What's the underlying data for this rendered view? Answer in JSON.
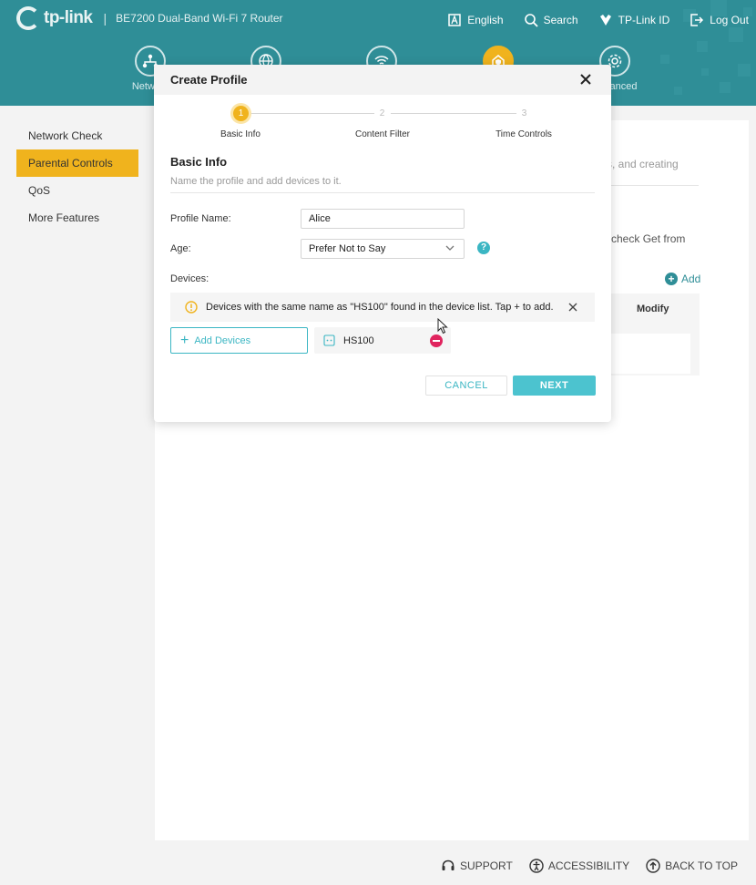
{
  "header": {
    "brand": "tp-link",
    "model": "BE7200 Dual-Band Wi-Fi 7 Router",
    "nav": [
      {
        "label": "English",
        "icon": "language-icon"
      },
      {
        "label": "Search",
        "icon": "search-icon"
      },
      {
        "label": "TP-Link ID",
        "icon": "tplink-id-icon"
      },
      {
        "label": "Log Out",
        "icon": "logout-icon"
      }
    ],
    "modules": [
      {
        "label": "Network",
        "icon": "network-icon"
      },
      {
        "label": "",
        "icon": "internet-icon"
      },
      {
        "label": "",
        "icon": "wireless-icon"
      },
      {
        "label": "",
        "icon": "security-icon",
        "active": true
      },
      {
        "label": "Advanced",
        "icon": "advanced-icon"
      }
    ],
    "accent": "#2f8e97",
    "active_color": "#f0b31d"
  },
  "sidebar": {
    "items": [
      {
        "label": "Network Check"
      },
      {
        "label": "Parental Controls",
        "active": true
      },
      {
        "label": "QoS"
      },
      {
        "label": "More Features"
      }
    ]
  },
  "background": {
    "text1": "mits, and creating",
    "text2": "o check Get from",
    "add_label": "Add",
    "modify_header": "Modify"
  },
  "modal": {
    "title": "Create Profile",
    "steps": [
      {
        "number": "1",
        "label": "Basic Info",
        "active": true
      },
      {
        "number": "2",
        "label": "Content Filter"
      },
      {
        "number": "3",
        "label": "Time Controls"
      }
    ],
    "section_title": "Basic Info",
    "section_subtitle": "Name the profile and add devices to it.",
    "profile_name_label": "Profile Name:",
    "profile_name_value": "Alice",
    "age_label": "Age:",
    "age_value": "Prefer Not to Say",
    "devices_label": "Devices:",
    "notice": "Devices with the same name as \"HS100\" found in the device list. Tap + to add.",
    "add_devices_label": "Add Devices",
    "device_name": "HS100",
    "cancel_label": "CANCEL",
    "next_label": "NEXT"
  },
  "footer": {
    "links": [
      {
        "label": "SUPPORT",
        "icon": "support-icon"
      },
      {
        "label": "ACCESSIBILITY",
        "icon": "accessibility-icon"
      },
      {
        "label": "BACK TO TOP",
        "icon": "back-to-top-icon"
      }
    ]
  }
}
